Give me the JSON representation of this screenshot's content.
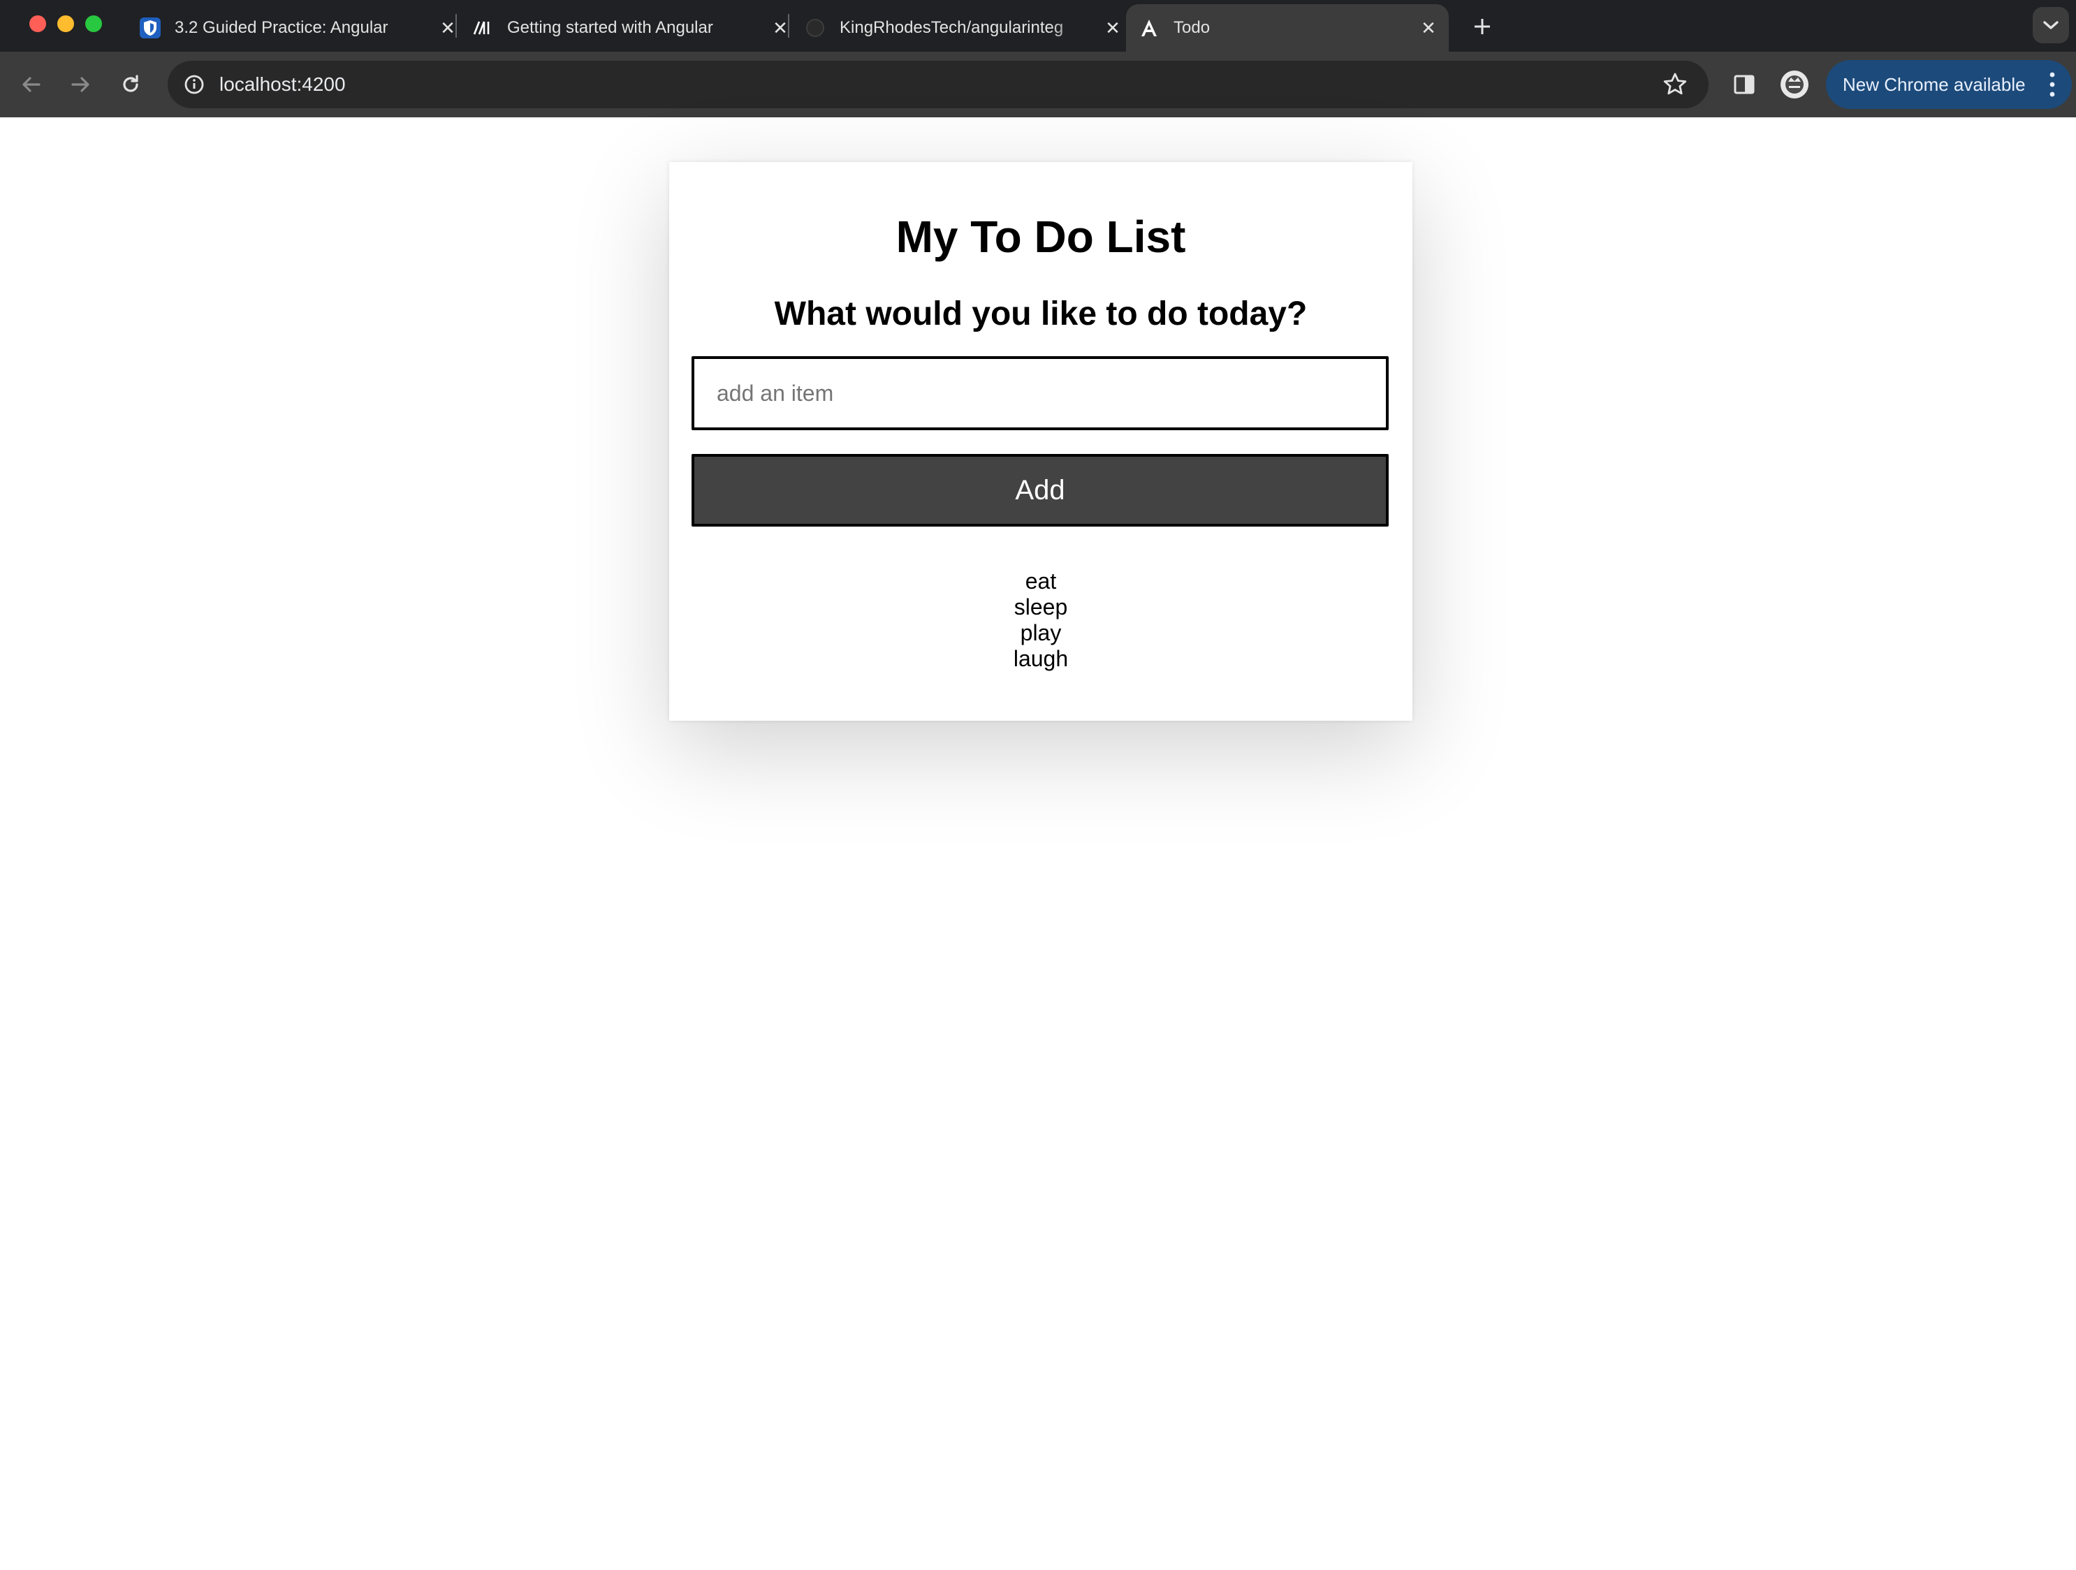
{
  "browser": {
    "tabs": [
      {
        "title": "3.2 Guided Practice: Angular",
        "favicon": "shield-icon",
        "active": false
      },
      {
        "title": "Getting started with Angular",
        "favicon": "mdn-icon",
        "active": false
      },
      {
        "title": "KingRhodesTech/angularinteg",
        "favicon": "github-icon",
        "active": false
      },
      {
        "title": "Todo",
        "favicon": "angular-icon",
        "active": true
      }
    ],
    "url": "localhost:4200",
    "update_label": "New Chrome available"
  },
  "app": {
    "title": "My To Do List",
    "subtitle": "What would you like to do today?",
    "input_placeholder": "add an item",
    "input_value": "",
    "add_label": "Add",
    "items": [
      "eat",
      "sleep",
      "play",
      "laugh"
    ]
  },
  "colors": {
    "button_bg": "#444344",
    "tabbar_bg": "#202124",
    "toolbar_bg": "#3c3c3c",
    "update_pill_bg": "#1c4a7a"
  }
}
